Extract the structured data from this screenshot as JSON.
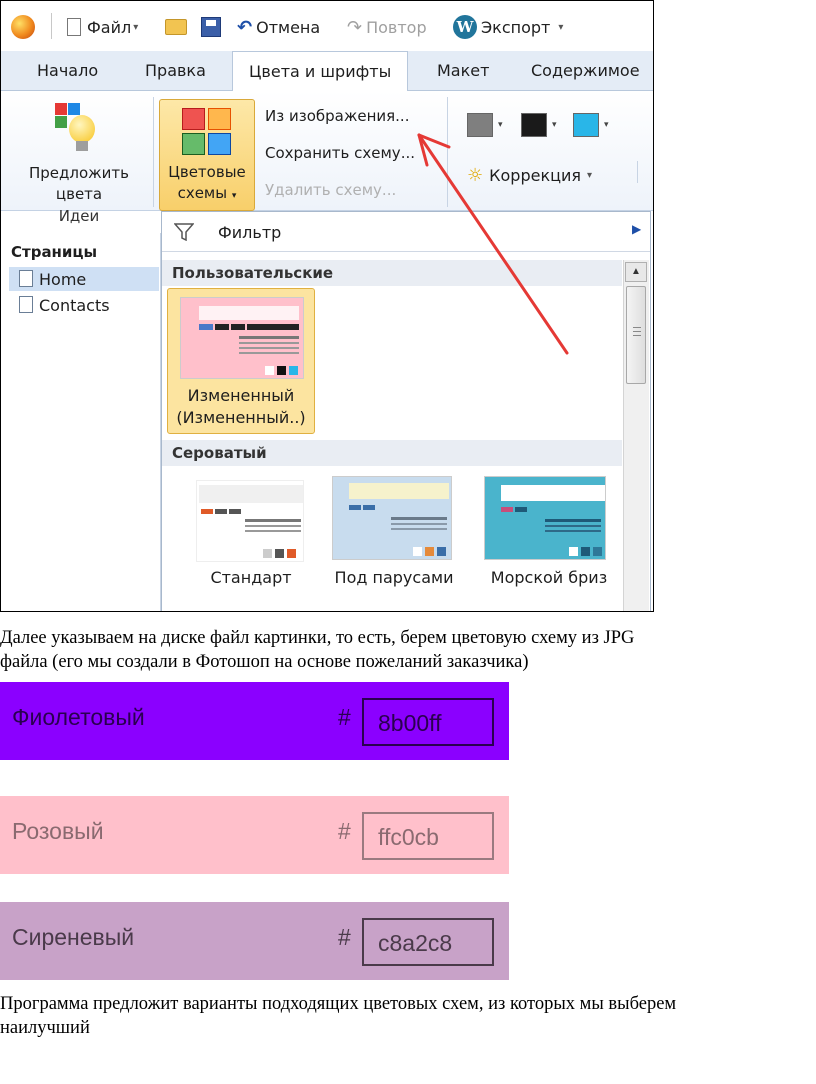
{
  "toolbar": {
    "file": "Файл",
    "undo": "Отмена",
    "redo": "Повтор",
    "export": "Экспорт"
  },
  "tabs": [
    "Начало",
    "Правка",
    "Цвета и шрифты",
    "Макет",
    "Содержимое"
  ],
  "ribbon": {
    "suggest_line1": "Предложить",
    "suggest_line2": "цвета",
    "group_ideas": "Идеи",
    "schemes_line1": "Цветовые",
    "schemes_line2": "схемы",
    "menu_from_image": "Из изображения...",
    "menu_save_scheme": "Сохранить схему...",
    "menu_delete_scheme": "Удалить схему...",
    "correction": "Коррекция",
    "swatch_colors": [
      "#7f7f7f",
      "#1a1a1a",
      "#29b6e8"
    ]
  },
  "pages": {
    "title": "Страницы",
    "items": [
      "Home",
      "Contacts"
    ]
  },
  "gallery": {
    "filter": "Фильтр",
    "section_custom": "Пользовательские",
    "custom_item_line1": "Измененный",
    "custom_item_line2": "(Измененный..)",
    "section_gray": "Сероватый",
    "gray_items": [
      "Стандарт",
      "Под парусами",
      "Морской бриз"
    ]
  },
  "text": {
    "para1_line1": "Далее указываем на диске файл картинки, то есть, берем цветовую схему из JPG",
    "para1_line2": "файла (его мы создали в Фотошоп на основе пожеланий заказчика)",
    "para2_line1": "Программа предложит варианты подходящих цветовых схем, из которых мы выберем",
    "para2_line2": "наилучший"
  },
  "colors": [
    {
      "name": "Фиолетовый",
      "hash": "#",
      "hex": "8b00ff",
      "bg": "#8b00ff",
      "fg": "#2a0050",
      "box": "#2a0050"
    },
    {
      "name": "Розовый",
      "hash": "#",
      "hex": "ffc0cb",
      "bg": "#ffc0cb",
      "fg": "#8a6a70",
      "box": "#9a7a80"
    },
    {
      "name": "Сиреневый",
      "hash": "#",
      "hex": "c8a2c8",
      "bg": "#c8a2c8",
      "fg": "#4a3a4a",
      "box": "#4a3a4a"
    }
  ]
}
